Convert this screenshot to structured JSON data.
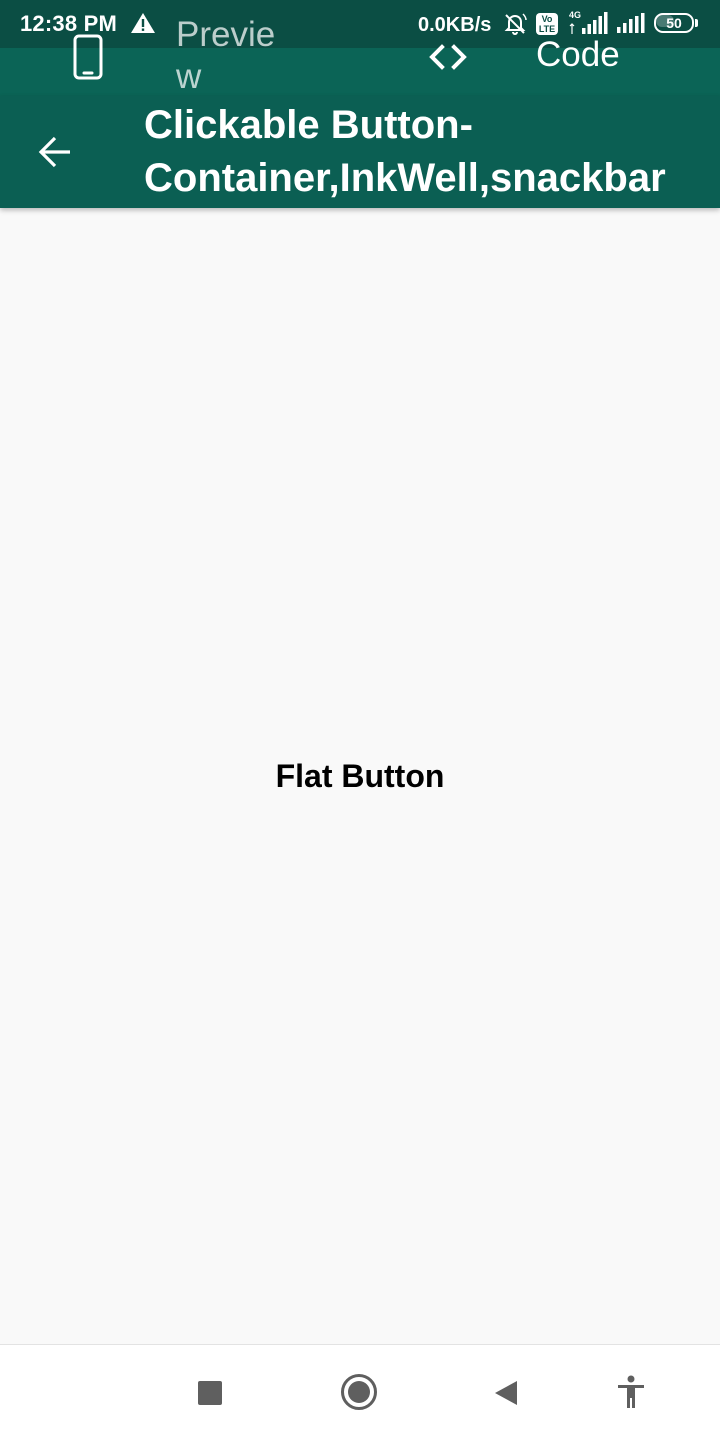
{
  "status_bar": {
    "time": "12:38 PM",
    "network_speed": "0.0KB/s",
    "volte_label": "Vo LTE",
    "network_type": "4G",
    "battery_level": "50",
    "icons": [
      "warning-icon",
      "bell-muted-icon",
      "volte-icon",
      "signal-4g-icon",
      "signal-icon",
      "battery-icon"
    ]
  },
  "tabs": {
    "preview_label": "Preview",
    "preview_icon": "phone-icon",
    "code_label": "Code",
    "code_icon": "code-brackets-icon"
  },
  "app_bar": {
    "back_icon": "arrow-back-icon",
    "title": "Clickable Button-Container,InkWell,snackbar"
  },
  "content": {
    "flat_button_label": "Flat Button"
  },
  "nav_bar": {
    "icons": [
      "recents-icon",
      "home-icon",
      "back-triangle-icon",
      "accessibility-icon"
    ]
  },
  "colors": {
    "status_bar_bg": "#0b4e44",
    "tab_strip_bg": "#0b6456",
    "app_bar_bg": "#0b5f53",
    "content_bg": "#f9f9f9",
    "nav_bar_bg": "#ffffff",
    "nav_icon": "#5f5f5f"
  }
}
